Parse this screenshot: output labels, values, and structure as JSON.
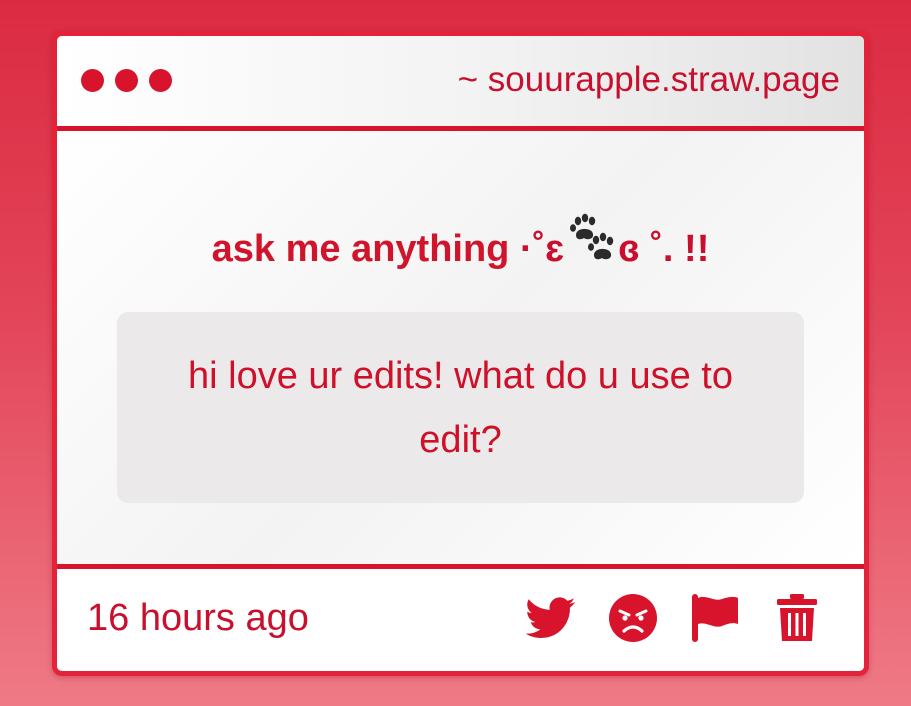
{
  "window": {
    "url": "~ souurapple.straw.page"
  },
  "prompt": {
    "text": "ask me anything",
    "decoration_left": "·˚ɛ",
    "decoration_right": "ɞ ˚. !!"
  },
  "question": {
    "text": "hi love ur edits! what do u use to edit?"
  },
  "footer": {
    "timestamp": "16 hours ago",
    "actions": [
      {
        "icon": "twitter-icon"
      },
      {
        "icon": "angry-face-icon"
      },
      {
        "icon": "flag-icon"
      },
      {
        "icon": "trash-icon"
      }
    ]
  },
  "colors": {
    "accent": "#d7142b",
    "background_top": "#db2b42",
    "background_bottom": "#ef7a86",
    "question_box": "#ebe9ea"
  }
}
